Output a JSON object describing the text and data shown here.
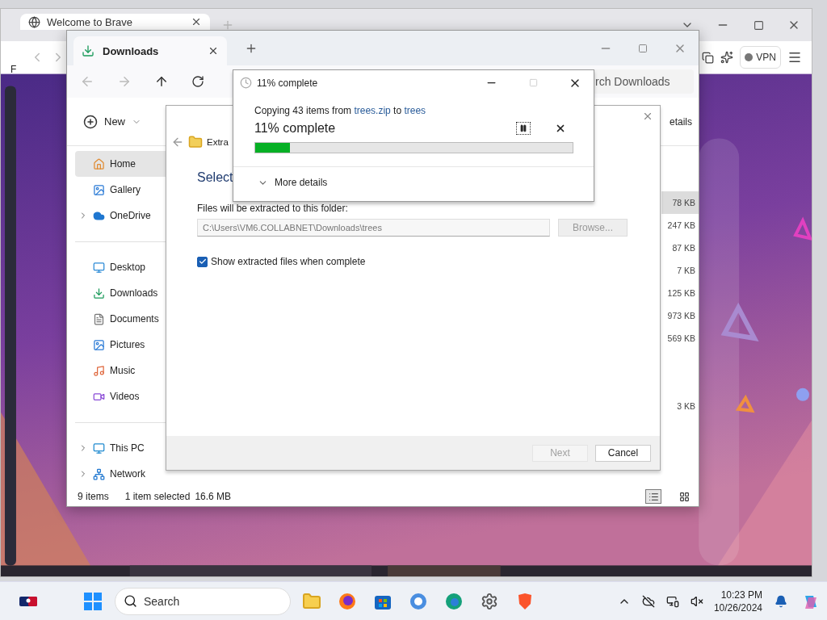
{
  "browser": {
    "tab": {
      "title": "Welcome to Brave",
      "selected": true
    },
    "bookmark_text": "F",
    "vpn": "VPN"
  },
  "explorer": {
    "tab": {
      "title": "Downloads",
      "selected": true
    },
    "search": {
      "placeholder": "rch Downloads"
    },
    "new_button": "New",
    "details_button": "etails",
    "sidebar": [
      [
        {
          "label": "Home",
          "selected": true,
          "expandable": false
        },
        {
          "label": "Gallery",
          "selected": false,
          "expandable": false
        },
        {
          "label": "OneDrive",
          "selected": false,
          "expandable": true
        }
      ],
      [
        {
          "label": "Desktop",
          "selected": false,
          "expandable": false
        },
        {
          "label": "Downloads",
          "selected": false,
          "expandable": false
        },
        {
          "label": "Documents",
          "selected": false,
          "expandable": false
        },
        {
          "label": "Pictures",
          "selected": false,
          "expandable": false
        },
        {
          "label": "Music",
          "selected": false,
          "expandable": false
        },
        {
          "label": "Videos",
          "selected": false,
          "expandable": false
        }
      ],
      [
        {
          "label": "This PC",
          "selected": false,
          "expandable": true
        },
        {
          "label": "Network",
          "selected": false,
          "expandable": true
        }
      ]
    ],
    "rows": [
      {
        "kind": "file",
        "size": "78 KB",
        "selected": true
      },
      {
        "kind": "file",
        "size": "247 KB",
        "selected": false
      },
      {
        "kind": "file",
        "size": "87 KB",
        "selected": false
      },
      {
        "kind": "file",
        "size": "7 KB",
        "selected": false
      },
      {
        "kind": "file",
        "size": "125 KB",
        "selected": false
      },
      {
        "kind": "file",
        "size": "973 KB",
        "selected": false
      },
      {
        "kind": "file",
        "size": "569 KB",
        "selected": false
      },
      {
        "kind": "folder"
      },
      {
        "kind": "folder"
      },
      {
        "kind": "file",
        "size": "3 KB",
        "selected": false
      }
    ],
    "status": {
      "count": "9 items",
      "selection": "1 item selected",
      "size": "16.6 MB"
    },
    "views": [
      {
        "kind": "details",
        "selected": true
      },
      {
        "kind": "tiles",
        "selected": false
      }
    ]
  },
  "extract_wizard": {
    "heading": "Extra",
    "step_title": "Select",
    "folder_label": "Files will be extracted to this folder:",
    "path": "C:\\Users\\VM6.COLLABNET\\Downloads\\trees",
    "browse": {
      "label": "Browse...",
      "disabled": true
    },
    "show_files": {
      "label": "Show extracted files when complete",
      "checked": true
    },
    "next": {
      "label": "Next",
      "disabled": true
    },
    "cancel": {
      "label": "Cancel",
      "disabled": false
    }
  },
  "progress": {
    "title": "11% complete",
    "message": [
      {
        "text": "Copying 43 items from ",
        "link": false
      },
      {
        "text": "trees.zip",
        "link": true
      },
      {
        "text": " to ",
        "link": false
      },
      {
        "text": "trees",
        "link": true
      }
    ],
    "status": "11% complete",
    "level": 0.11,
    "more": "More details"
  },
  "taskbar": {
    "search_placeholder": "Search",
    "time": "10:23 PM",
    "date": "10/26/2024"
  }
}
